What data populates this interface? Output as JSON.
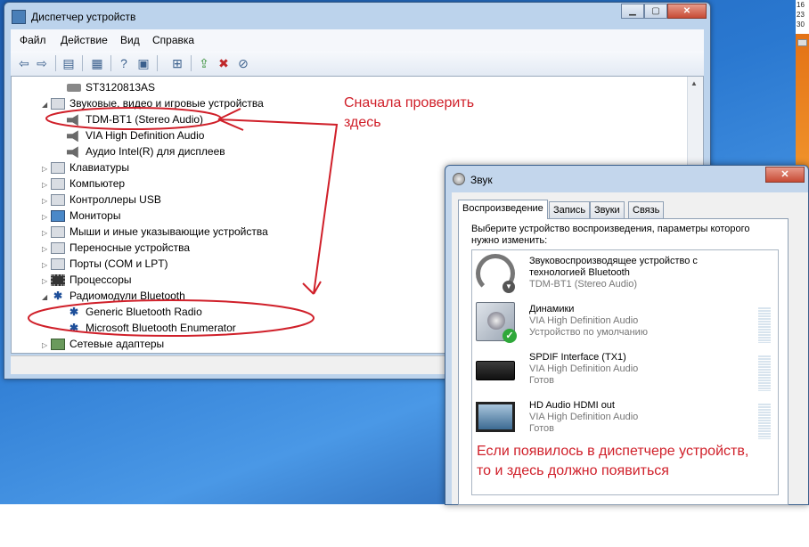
{
  "colors": {
    "annotation": "#d0202a",
    "desktop": "#2a78d0"
  },
  "tray": {
    "clock_lines": [
      "16",
      "23",
      "30"
    ]
  },
  "device_manager": {
    "title": "Диспетчер устройств",
    "title_icon": "device-manager-icon",
    "menu": [
      "Файл",
      "Действие",
      "Вид",
      "Справка"
    ],
    "toolbar_icons": [
      "back-icon",
      "forward-icon",
      "up-icon",
      "properties-icon",
      "help-icon",
      "show-hidden-icon",
      "scan-hardware-icon",
      "update-driver-icon",
      "uninstall-icon",
      "disable-icon"
    ],
    "tree": [
      {
        "label": "ST3120813AS",
        "icon": "disk-icon",
        "level": 2,
        "exp": ""
      },
      {
        "label": "Звуковые, видео и игровые устройства",
        "icon": "sound-category-icon",
        "level": 1,
        "exp": "◢"
      },
      {
        "label": "TDM-BT1 (Stereo Audio)",
        "icon": "speaker-icon",
        "level": 2,
        "exp": ""
      },
      {
        "label": "VIA High Definition Audio",
        "icon": "speaker-icon",
        "level": 2,
        "exp": ""
      },
      {
        "label": "Аудио Intel(R) для дисплеев",
        "icon": "speaker-icon",
        "level": 2,
        "exp": ""
      },
      {
        "label": "Клавиатуры",
        "icon": "keyboard-icon",
        "level": 1,
        "exp": "▷"
      },
      {
        "label": "Компьютер",
        "icon": "computer-icon",
        "level": 1,
        "exp": "▷"
      },
      {
        "label": "Контроллеры USB",
        "icon": "usb-icon",
        "level": 1,
        "exp": "▷"
      },
      {
        "label": "Мониторы",
        "icon": "monitor-icon",
        "level": 1,
        "exp": "▷"
      },
      {
        "label": "Мыши и иные указывающие устройства",
        "icon": "mouse-icon",
        "level": 1,
        "exp": "▷"
      },
      {
        "label": "Переносные устройства",
        "icon": "portable-device-icon",
        "level": 1,
        "exp": "▷"
      },
      {
        "label": "Порты (COM и LPT)",
        "icon": "port-icon",
        "level": 1,
        "exp": "▷"
      },
      {
        "label": "Процессоры",
        "icon": "cpu-icon",
        "level": 1,
        "exp": "▷"
      },
      {
        "label": "Радиомодули Bluetooth",
        "icon": "bluetooth-icon",
        "level": 1,
        "exp": "◢"
      },
      {
        "label": "Generic Bluetooth Radio",
        "icon": "bluetooth-icon",
        "level": 2,
        "exp": ""
      },
      {
        "label": "Microsoft Bluetooth Enumerator",
        "icon": "bluetooth-icon",
        "level": 2,
        "exp": ""
      },
      {
        "label": "Сетевые адаптеры",
        "icon": "network-adapter-icon",
        "level": 1,
        "exp": "▷"
      }
    ]
  },
  "annotations": {
    "check_here": [
      "Сначала проверить",
      "здесь"
    ],
    "should_appear": [
      "Если появилось в диспетчере устройств,",
      "то и здесь должно появиться"
    ]
  },
  "sound": {
    "title": "Звук",
    "tabs": [
      "Воспроизведение",
      "Запись",
      "Звуки",
      "Связь"
    ],
    "active_tab": 0,
    "instruction": "Выберите устройство воспроизведения, параметры которого нужно изменить:",
    "devices": [
      {
        "name": "Звуковоспроизводящее устройство с технологией Bluetooth",
        "line2": "TDM-BT1 (Stereo Audio)",
        "line3": "",
        "icon": "headphones-icon",
        "vu": false
      },
      {
        "name": "Динамики",
        "line2": "VIA High Definition Audio",
        "line3": "Устройство по умолчанию",
        "icon": "speakers-icon",
        "vu": true
      },
      {
        "name": "SPDIF Interface (TX1)",
        "line2": "VIA High Definition Audio",
        "line3": "Готов",
        "icon": "spdif-receiver-icon",
        "vu": true
      },
      {
        "name": "HD Audio HDMI out",
        "line2": "VIA High Definition Audio",
        "line3": "Готов",
        "icon": "hdmi-tv-icon",
        "vu": true
      }
    ]
  }
}
